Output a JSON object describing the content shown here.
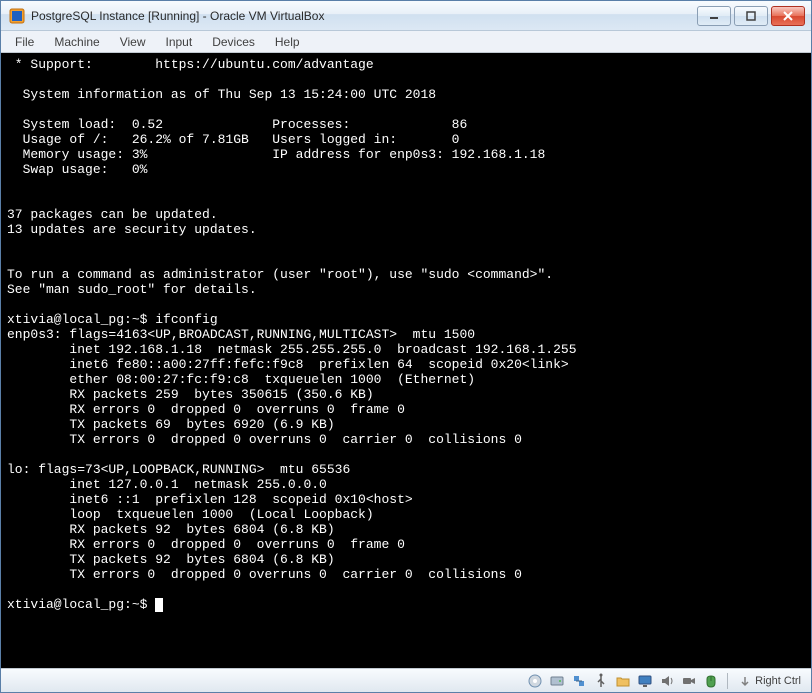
{
  "window": {
    "title": "PostgreSQL Instance [Running] - Oracle VM VirtualBox"
  },
  "menu": {
    "file": "File",
    "machine": "Machine",
    "view": "View",
    "input": "Input",
    "devices": "Devices",
    "help": "Help"
  },
  "terminal": {
    "support_label": " * Support:        https://ubuntu.com/advantage",
    "sysinfo_header": "  System information as of Thu Sep 13 15:24:00 UTC 2018",
    "row1": "  System load:  0.52              Processes:             86",
    "row2": "  Usage of /:   26.2% of 7.81GB   Users logged in:       0",
    "row3": "  Memory usage: 3%                IP address for enp0s3: 192.168.1.18",
    "row4": "  Swap usage:   0%",
    "pkg1": "37 packages can be updated.",
    "pkg2": "13 updates are security updates.",
    "admin1": "To run a command as administrator (user \"root\"), use \"sudo <command>\".",
    "admin2": "See \"man sudo_root\" for details.",
    "prompt1": "xtivia@local_pg:~$ ifconfig",
    "if_enp0s3_1": "enp0s3: flags=4163<UP,BROADCAST,RUNNING,MULTICAST>  mtu 1500",
    "if_enp0s3_2": "        inet 192.168.1.18  netmask 255.255.255.0  broadcast 192.168.1.255",
    "if_enp0s3_3": "        inet6 fe80::a00:27ff:fefc:f9c8  prefixlen 64  scopeid 0x20<link>",
    "if_enp0s3_4": "        ether 08:00:27:fc:f9:c8  txqueuelen 1000  (Ethernet)",
    "if_enp0s3_5": "        RX packets 259  bytes 350615 (350.6 KB)",
    "if_enp0s3_6": "        RX errors 0  dropped 0  overruns 0  frame 0",
    "if_enp0s3_7": "        TX packets 69  bytes 6920 (6.9 KB)",
    "if_enp0s3_8": "        TX errors 0  dropped 0 overruns 0  carrier 0  collisions 0",
    "if_lo_1": "lo: flags=73<UP,LOOPBACK,RUNNING>  mtu 65536",
    "if_lo_2": "        inet 127.0.0.1  netmask 255.0.0.0",
    "if_lo_3": "        inet6 ::1  prefixlen 128  scopeid 0x10<host>",
    "if_lo_4": "        loop  txqueuelen 1000  (Local Loopback)",
    "if_lo_5": "        RX packets 92  bytes 6804 (6.8 KB)",
    "if_lo_6": "        RX errors 0  dropped 0  overruns 0  frame 0",
    "if_lo_7": "        TX packets 92  bytes 6804 (6.8 KB)",
    "if_lo_8": "        TX errors 0  dropped 0 overruns 0  carrier 0  collisions 0",
    "prompt2": "xtivia@local_pg:~$ "
  },
  "status": {
    "host_key": "Right Ctrl",
    "icons": {
      "cd": "optical-drive-icon",
      "hd": "hard-disk-icon",
      "net": "network-icon",
      "usb": "usb-icon",
      "shared": "shared-folder-icon",
      "display": "display-icon",
      "audio": "audio-icon",
      "capture": "video-capture-icon",
      "mouse": "mouse-integration-icon",
      "hostkey_arrow": "host-key-arrow-icon"
    }
  },
  "colors": {
    "terminal_bg": "#000000",
    "terminal_fg": "#ffffff",
    "titlebar_start": "#f8fbfe",
    "titlebar_end": "#dce8f4",
    "close_btn": "#d84830"
  }
}
